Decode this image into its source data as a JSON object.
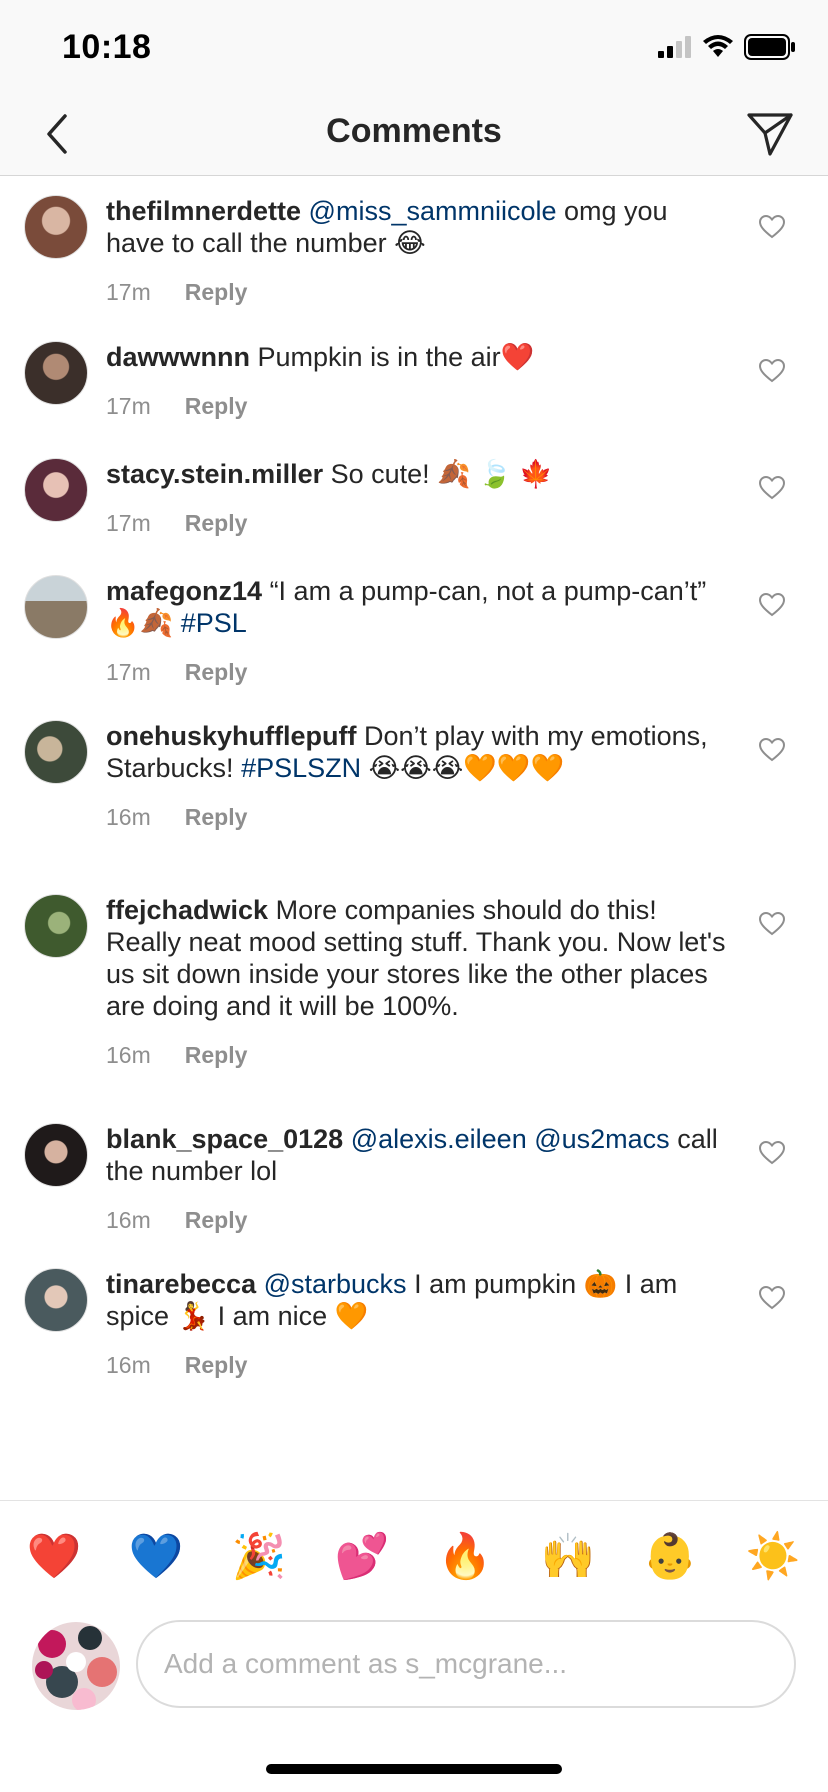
{
  "status_bar": {
    "time": "10:18"
  },
  "nav": {
    "title": "Comments",
    "back_icon": "chevron-left-icon",
    "send_icon": "paper-plane-icon"
  },
  "comments": [
    {
      "username": "thefilmnerdette",
      "segments": [
        {
          "type": "mention",
          "text": "@miss_sammniicole"
        },
        {
          "type": "text",
          "text": " omg you have to call the number 😂"
        }
      ],
      "time": "17m",
      "reply_label": "Reply",
      "avatar_color": "#7a4b3a"
    },
    {
      "username": "dawwwnnn",
      "segments": [
        {
          "type": "text",
          "text": "Pumpkin is in the air❤️"
        }
      ],
      "time": "17m",
      "reply_label": "Reply",
      "avatar_color": "#3b2f2a"
    },
    {
      "username": "stacy.stein.miller",
      "segments": [
        {
          "type": "text",
          "text": "So cute! 🍂 🍃 🍁"
        }
      ],
      "time": "17m",
      "reply_label": "Reply",
      "avatar_color": "#5a2b3a"
    },
    {
      "username": "mafegonz14",
      "segments": [
        {
          "type": "text",
          "text": "“I am a pump-can, not a pump-can’t” 🔥🍂 "
        },
        {
          "type": "mention",
          "text": "#PSL"
        }
      ],
      "time": "17m",
      "reply_label": "Reply",
      "avatar_color": "#8a7a66"
    },
    {
      "username": "onehuskyhufflepuff",
      "segments": [
        {
          "type": "text",
          "text": "Don’t play with my emotions, Starbucks! "
        },
        {
          "type": "mention",
          "text": "#PSLSZN"
        },
        {
          "type": "text",
          "text": " 😭😭😭🧡🧡🧡"
        }
      ],
      "time": "16m",
      "reply_label": "Reply",
      "avatar_color": "#3d4a3a"
    },
    {
      "username": "ffejchadwick",
      "segments": [
        {
          "type": "text",
          "text": "More companies should do this! Really neat mood setting stuff. Thank you. Now let's us sit down inside your stores like the other places are doing and it will be 100%."
        }
      ],
      "time": "16m",
      "reply_label": "Reply",
      "avatar_color": "#3f5a2e"
    },
    {
      "username": "blank_space_0128",
      "segments": [
        {
          "type": "mention",
          "text": "@alexis.eileen"
        },
        {
          "type": "text",
          "text": " "
        },
        {
          "type": "mention",
          "text": "@us2macs"
        },
        {
          "type": "text",
          "text": " call the number lol"
        }
      ],
      "time": "16m",
      "reply_label": "Reply",
      "avatar_color": "#1f1a1a"
    },
    {
      "username": "tinarebecca",
      "segments": [
        {
          "type": "mention",
          "text": "@starbucks"
        },
        {
          "type": "text",
          "text": " I am pumpkin 🎃 I am spice 💃 I am nice 🧡"
        }
      ],
      "time": "16m",
      "reply_label": "Reply",
      "avatar_color": "#4a5a5e"
    }
  ],
  "emoji_bar": [
    "❤️",
    "💙",
    "🎉",
    "💕",
    "🔥",
    "🙌",
    "👶",
    "☀️"
  ],
  "composer": {
    "placeholder": "Add a comment as s_mcgrane..."
  },
  "colors": {
    "mention": "#003569",
    "meta": "#8e8e8e",
    "text": "#262626"
  }
}
